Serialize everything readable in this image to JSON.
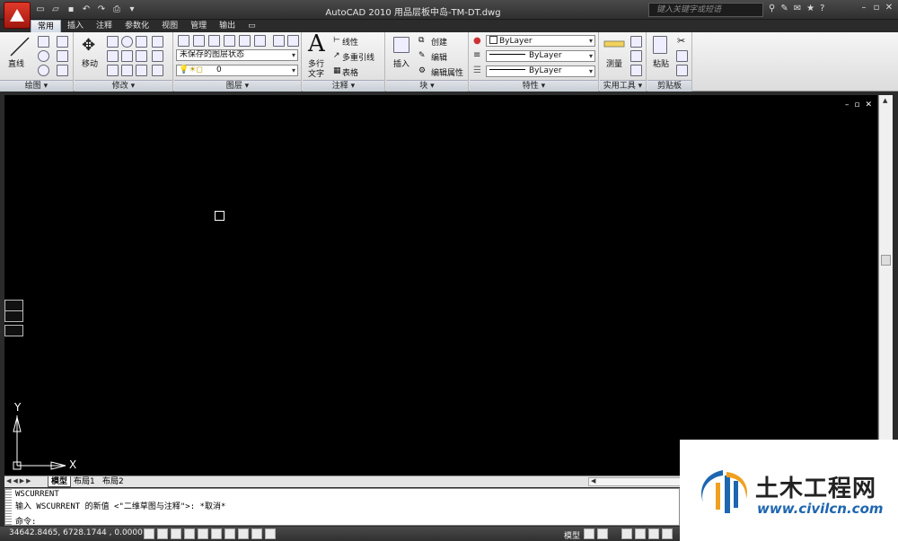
{
  "window": {
    "title": "AutoCAD 2010   用品层板中岛-TM-DT.dwg",
    "search_placeholder": "键入关键字或短语"
  },
  "ribbon": {
    "tabs": [
      "常用",
      "插入",
      "注释",
      "参数化",
      "视图",
      "管理",
      "输出"
    ],
    "active_tab": "常用",
    "draw": {
      "title": "绘图 ▾",
      "line_label": "直线"
    },
    "modify": {
      "title": "修改 ▾",
      "move_label": "移动"
    },
    "layers": {
      "title": "图层 ▾",
      "layer_state": "未保存的图层状态",
      "current_layer": "0"
    },
    "annotation": {
      "title": "注释 ▾",
      "mtext_label1": "多行",
      "mtext_label2": "文字",
      "linear": "线性",
      "multileader": "多重引线",
      "table": "表格"
    },
    "block": {
      "title": "块 ▾",
      "insert": "插入",
      "create": "创建",
      "edit": "编辑",
      "edit_attrs": "编辑属性"
    },
    "properties": {
      "title": "特性 ▾",
      "color": "ByLayer",
      "linetype": "ByLayer",
      "lineweight": "ByLayer"
    },
    "utilities": {
      "title": "实用工具 ▾",
      "measure": "测量"
    },
    "clipboard": {
      "title": "剪贴板",
      "paste": "粘贴"
    }
  },
  "drawing": {
    "ucs_y": "Y",
    "ucs_x": "X"
  },
  "layout_tabs": [
    "模型",
    "布局1",
    "布局2"
  ],
  "command": {
    "lines": [
      "WSCURRENT",
      "输入 WSCURRENT 的新值 <\"二维草图与注释\">: *取消*",
      "命令:"
    ]
  },
  "status": {
    "coords": "34642.8465, 6728.1744 , 0.0000",
    "model": "模型"
  },
  "watermark": {
    "name": "土木工程网",
    "url": "www.civilcn.com"
  }
}
